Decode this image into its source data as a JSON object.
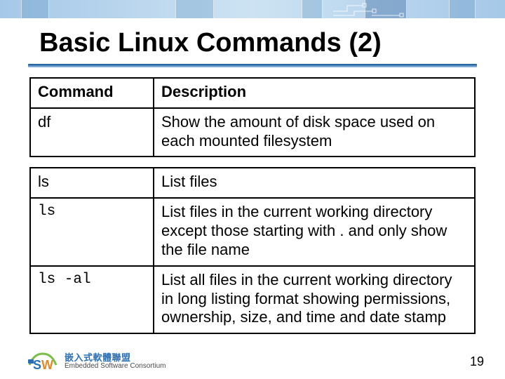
{
  "title": "Basic Linux Commands (2)",
  "table1": {
    "head_cmd": "Command",
    "head_desc": "Description",
    "row1_cmd": "df",
    "row1_desc": "Show the amount of disk space used on each mounted filesystem"
  },
  "table2": {
    "row1_cmd": "ls",
    "row1_desc": "List files",
    "row2_cmd": "ls",
    "row2_desc": "List files in the current working directory except those starting with . and only show the file name",
    "row3_cmd": "ls -al",
    "row3_desc": "List all files in the current working directory in long listing format showing permissions, ownership, size, and time and date stamp"
  },
  "footer": {
    "brand_zh": "嵌入式軟體聯盟",
    "brand_en": "Embedded Software Consortium",
    "page": "19"
  }
}
